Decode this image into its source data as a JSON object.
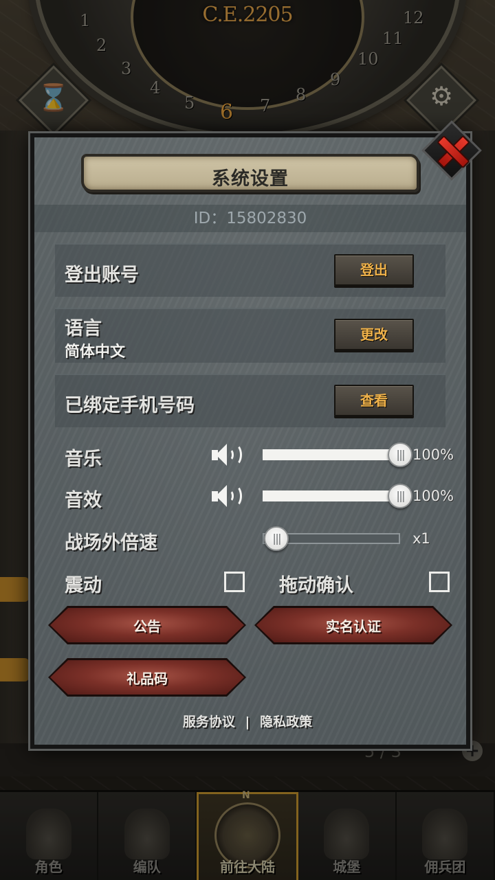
{
  "background": {
    "era": "C.E.2205",
    "dial_numbers": [
      "1",
      "2",
      "3",
      "4",
      "5",
      "6",
      "7",
      "8",
      "9",
      "10",
      "11",
      "12"
    ],
    "current_number": "6",
    "map_count": "5 / 3"
  },
  "dialog": {
    "title": "系统设置",
    "id_text": "ID：15802830",
    "rows": {
      "logout": {
        "label": "登出账号",
        "button": "登出"
      },
      "language": {
        "label": "语言",
        "value": "简体中文",
        "button": "更改"
      },
      "phone": {
        "label": "已绑定手机号码",
        "button": "查看"
      }
    },
    "music": {
      "label": "音乐",
      "value_pct": 100,
      "display": "100%"
    },
    "sfx": {
      "label": "音效",
      "value_pct": 100,
      "display": "100%"
    },
    "speed": {
      "label": "战场外倍速",
      "value_fraction": 0.1,
      "display": "x1"
    },
    "vibration": {
      "label": "震动",
      "checked": false
    },
    "drag_confirm": {
      "label": "拖动确认",
      "checked": false
    },
    "buttons": {
      "notice": "公告",
      "realname": "实名认证",
      "giftcode": "礼品码"
    },
    "footer": {
      "service": "服务协议",
      "separator": "|",
      "privacy": "隐私政策"
    }
  },
  "nav": {
    "compass_n": "N",
    "items": [
      {
        "label": "角色",
        "icon": "knight-helmet-icon"
      },
      {
        "label": "编队",
        "icon": "armor-icon"
      },
      {
        "label": "前往大陆",
        "icon": "compass-icon",
        "active": true
      },
      {
        "label": "城堡",
        "icon": "castle-icon"
      },
      {
        "label": "佣兵团",
        "icon": "mercenary-flag-icon"
      }
    ]
  },
  "colors": {
    "accent_gold": "#f0b24a",
    "close_red": "#e8392b",
    "button_red": "#7b3028"
  }
}
